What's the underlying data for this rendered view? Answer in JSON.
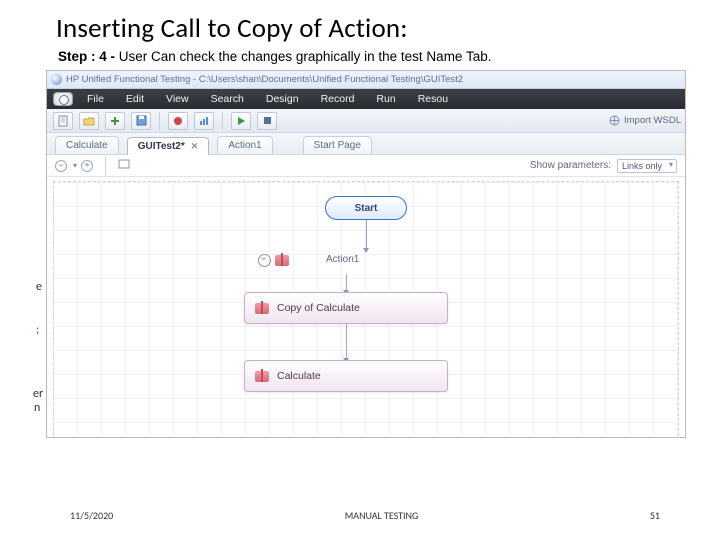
{
  "slide": {
    "title": "Inserting Call to Copy of Action:",
    "step_prefix": "Step : 4 - ",
    "step_text": "User Can check the changes graphically in the test Name Tab."
  },
  "app": {
    "titlebar": "HP Unified Functional Testing - C:\\Users\\shan\\Documents\\Unified Functional Testing\\GUITest2",
    "menu": [
      "File",
      "Edit",
      "View",
      "Search",
      "Design",
      "Record",
      "Run",
      "Resou"
    ],
    "toolbar_right_import": "Import WSDL",
    "doc_tabs": [
      {
        "label": "Calculate",
        "active": false,
        "closable": false
      },
      {
        "label": "GUITest2*",
        "active": true,
        "closable": true
      },
      {
        "label": "Action1",
        "active": false,
        "closable": false
      },
      {
        "label": "Start Page",
        "active": false,
        "closable": false
      }
    ],
    "canvasbar": {
      "show_params": "Show parameters:",
      "param_value": "Links only"
    },
    "flow": {
      "start": "Start",
      "action_label": "Action1",
      "box_copy": "Copy of Calculate",
      "box_calc": "Calculate"
    }
  },
  "footer": {
    "date": "11/5/2020",
    "center": "MANUAL TESTING",
    "page": "51"
  }
}
